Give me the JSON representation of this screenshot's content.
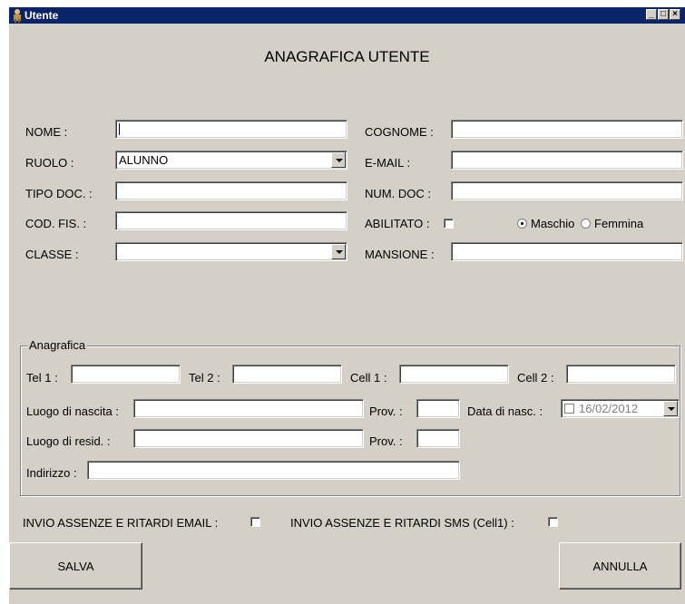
{
  "window": {
    "title": "Utente",
    "min_btn": "_",
    "max_btn": "□",
    "close_btn": "×"
  },
  "heading": "ANAGRAFICA UTENTE",
  "form": {
    "nome_label": "NOME :",
    "nome_value": "",
    "cognome_label": "COGNOME :",
    "cognome_value": "",
    "ruolo_label": "RUOLO :",
    "ruolo_value": "ALUNNO",
    "email_label": "E-MAIL :",
    "email_value": "",
    "tipo_doc_label": "TIPO DOC. :",
    "tipo_doc_value": "",
    "num_doc_label": "NUM. DOC :",
    "num_doc_value": "",
    "cod_fis_label": "COD. FIS. :",
    "cod_fis_value": "",
    "abilitato_label": "ABILITATO :",
    "abilitato_checked": false,
    "maschio_label": "Maschio",
    "femmina_label": "Femmina",
    "gender_selected": "Maschio",
    "classe_label": "CLASSE :",
    "classe_value": "",
    "mansione_label": "MANSIONE :",
    "mansione_value": ""
  },
  "anagrafica": {
    "legend": "Anagrafica",
    "tel1_label": "Tel 1 :",
    "tel2_label": "Tel 2 :",
    "cell1_label": "Cell 1 :",
    "cell2_label": "Cell 2 :",
    "luogo_nascita_label": "Luogo di nascita :",
    "prov1_label": "Prov. :",
    "data_nasc_label": "Data di nasc. :",
    "data_nasc_value": "16/02/2012",
    "luogo_resid_label": "Luogo di resid. :",
    "prov2_label": "Prov. :",
    "indirizzo_label": "Indirizzo :"
  },
  "notifications": {
    "email_label": "INVIO ASSENZE E RITARDI  EMAIL :",
    "sms_label": "INVIO ASSENZE E RITARDI  SMS (Cell1) :"
  },
  "buttons": {
    "save": "SALVA",
    "cancel": "ANNULLA"
  }
}
